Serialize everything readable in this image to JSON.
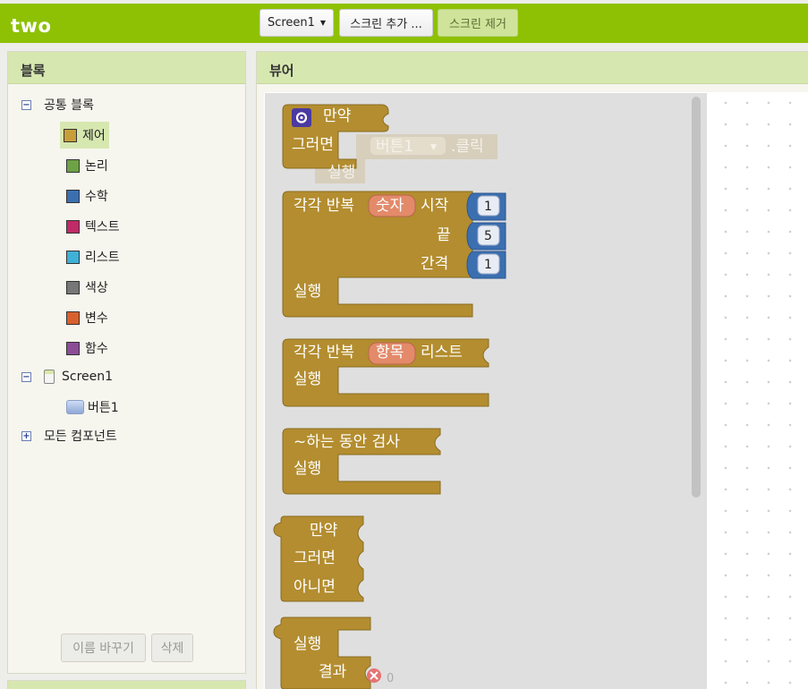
{
  "header": {
    "project_name": "two",
    "screen_select": "Screen1",
    "add_screen": "스크린 추가 ...",
    "remove_screen": "스크린 제거"
  },
  "blocks_panel": {
    "title": "블록",
    "built_in": "공통 블록",
    "categories": [
      {
        "label": "제어",
        "color": "#c89e38"
      },
      {
        "label": "논리",
        "color": "#6ea246"
      },
      {
        "label": "수학",
        "color": "#3b6fb0"
      },
      {
        "label": "텍스트",
        "color": "#c02a66"
      },
      {
        "label": "리스트",
        "color": "#3fb0d6"
      },
      {
        "label": "색상",
        "color": "#777777"
      },
      {
        "label": "변수",
        "color": "#d8602e"
      },
      {
        "label": "함수",
        "color": "#8a4d96"
      }
    ],
    "screen": "Screen1",
    "component": "버튼1",
    "any_component": "모든 컴포넌트",
    "rename_button": "이름 바꾸기",
    "delete_button": "삭제"
  },
  "viewer": {
    "title": "뷰어",
    "event_block": {
      "when": "만약",
      "component": "버튼1",
      "event": ".클릭",
      "do": "그러면",
      "ghost_do": "실행"
    },
    "for_range": {
      "prefix": "각각 반복",
      "var": "숫자",
      "from": "시작",
      "to": "끝",
      "by": "간격",
      "from_value": "1",
      "to_value": "5",
      "by_value": "1",
      "do": "실행"
    },
    "for_each": {
      "prefix": "각각 반복",
      "var": "항목",
      "list": "리스트",
      "do": "실행"
    },
    "while": {
      "label": "~하는 동안 검사",
      "do": "실행"
    },
    "if_else": {
      "if": "만약",
      "then": "그러면",
      "else": "아니면"
    },
    "do_result": {
      "do": "실행",
      "result": "결과",
      "value": "0"
    }
  },
  "colors": {
    "control": "#b38d2f",
    "math": "#3b6fb0",
    "var_chip": "#e38a6a",
    "green": "#8ec104"
  }
}
